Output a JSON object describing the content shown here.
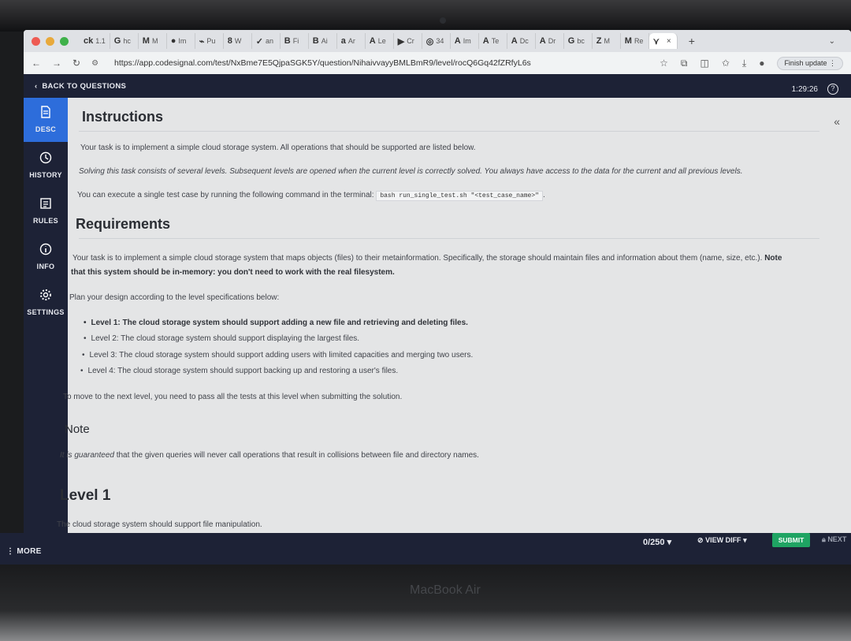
{
  "browser": {
    "tabs": [
      {
        "icon": "ck",
        "label": "1.1"
      },
      {
        "icon": "G",
        "label": "hc"
      },
      {
        "icon": "M",
        "label": "M"
      },
      {
        "icon": "●",
        "label": "Im"
      },
      {
        "icon": "⌁",
        "label": "Pu"
      },
      {
        "icon": "8",
        "label": "W"
      },
      {
        "icon": "✓",
        "label": "an"
      },
      {
        "icon": "B",
        "label": "Fi"
      },
      {
        "icon": "B",
        "label": "Ai"
      },
      {
        "icon": "a",
        "label": "Ar"
      },
      {
        "icon": "A",
        "label": "Le"
      },
      {
        "icon": "▶",
        "label": "Cr"
      },
      {
        "icon": "◎",
        "label": "34"
      },
      {
        "icon": "A",
        "label": "Im"
      },
      {
        "icon": "A",
        "label": "Te"
      },
      {
        "icon": "A",
        "label": "Dc"
      },
      {
        "icon": "A",
        "label": "Dr"
      },
      {
        "icon": "G",
        "label": "bc"
      },
      {
        "icon": "Z",
        "label": "M"
      },
      {
        "icon": "M",
        "label": "Re"
      },
      {
        "icon": "⋎",
        "label": ""
      }
    ],
    "new_tab": "+",
    "url": "https://app.codesignal.com/test/NxBme7E5QjpaSGK5Y/question/NihaivvayyBMLBmR9/level/rocQ6Gq42fZRfyL6s",
    "finish_update": "Finish update"
  },
  "app": {
    "back_label": "BACK TO QUESTIONS",
    "timer": "1:29:26",
    "help": "?",
    "collapse": "«"
  },
  "sidebar": {
    "items": [
      {
        "label": "DESC",
        "icon": "document-icon"
      },
      {
        "label": "HISTORY",
        "icon": "clock-icon"
      },
      {
        "label": "RULES",
        "icon": "list-icon"
      },
      {
        "label": "INFO",
        "icon": "info-icon"
      },
      {
        "label": "SETTINGS",
        "icon": "gear-icon"
      }
    ]
  },
  "content": {
    "instructions_title": "Instructions",
    "p1": "Your task is to implement a simple cloud storage system. All operations that should be supported are listed below.",
    "p2": "Solving this task consists of several levels. Subsequent levels are opened when the current level is correctly solved. You always have access to the data for the current and all previous levels.",
    "p3_prefix": "You can execute a single test case by running the following command in the terminal:",
    "p3_code": "bash run_single_test.sh \"<test_case_name>\"",
    "p3_suffix": ".",
    "requirements_title": "Requirements",
    "req_p1": "Your task is to implement a simple cloud storage system that maps objects (files) to their metainformation. Specifically, the storage should maintain files and information about them (name, size, etc.).",
    "req_note_a": "Note",
    "req_note_b": "that this system should be in-memory: you don't need to work with the real filesystem.",
    "plan": "Plan your design according to the level specifications below:",
    "levels": [
      "Level 1: The cloud storage system should support adding a new file and retrieving and deleting files.",
      "Level 2: The cloud storage system should support displaying the largest files.",
      "Level 3: The cloud storage system should support adding users with limited capacities and merging two users.",
      "Level 4: The cloud storage system should support backing up and restoring a user's files."
    ],
    "move_next": "To move to the next level, you need to pass all the tests at this level when submitting the solution.",
    "note_title": "Note",
    "note_italic": "It is guaranteed",
    "note_rest": "that the given queries will never call operations that result in collisions between file and directory names.",
    "level1_title": "Level 1",
    "level1_text": "The cloud storage system should support file manipulation."
  },
  "footer": {
    "more": "MORE",
    "score": "0/250",
    "view_diff": "VIEW DIFF",
    "submit": "SUBMIT",
    "next": "NEXT"
  },
  "device_label": "MacBook Air",
  "colors": {
    "app_dark": "#1d2236",
    "active_nav": "#2d6ddb",
    "submit_green": "#1fa463",
    "content_bg": "#e4e5e6"
  }
}
